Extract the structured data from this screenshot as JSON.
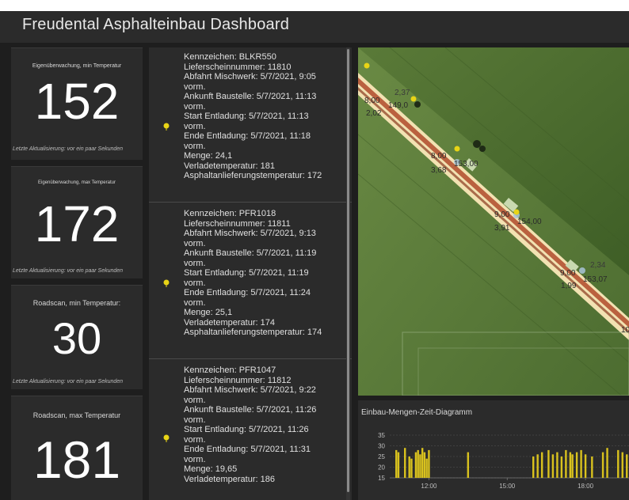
{
  "header": {
    "title": "Freudental Asphalteinbau Dashboard"
  },
  "indicators": [
    {
      "label": "Eigenüberwachung, min Temperatur",
      "value": "152",
      "updated": "Letzte Aktualisierung: vor ein paar Sekunden"
    },
    {
      "label": "Eigenüberwachung, max Temperatur",
      "value": "172",
      "updated": "Letzte Aktualisierung: vor ein paar Sekunden"
    },
    {
      "label": "Roadscan, min Temperatur:",
      "value": "30",
      "updated": "Letzte Aktualisierung: vor ein paar Sekunden"
    },
    {
      "label": "Roadscan, max Temperatur",
      "value": "181",
      "updated": "Letzte Aktualisierung: vor ein paar Sekunden"
    }
  ],
  "deliveries": [
    {
      "lines": [
        "Kennzeichen: BLKR550",
        "Lieferscheinnummer: 11810",
        "Abfahrt Mischwerk: 5/7/2021, 9:05",
        "vorm.",
        "Ankunft Baustelle: 5/7/2021, 11:13",
        "vorm.",
        "Start Entladung: 5/7/2021, 11:13",
        "vorm.",
        "Ende Entladung: 5/7/2021, 11:18",
        "vorm.",
        "Menge: 24,1",
        "Verladetemperatur: 181",
        "Asphaltanlieferungstemperatur: 172"
      ]
    },
    {
      "lines": [
        "Kennzeichen: PFR1018",
        "Lieferscheinnummer: 11811",
        "Abfahrt Mischwerk: 5/7/2021, 9:13",
        "vorm.",
        "Ankunft Baustelle: 5/7/2021, 11:19",
        "vorm.",
        "Start Entladung: 5/7/2021, 11:19",
        "vorm.",
        "Ende Entladung: 5/7/2021, 11:24",
        "vorm.",
        "Menge: 25,1",
        "Verladetemperatur: 174",
        "Asphaltanlieferungstemperatur: 174"
      ]
    },
    {
      "lines": [
        "Kennzeichen: PFR1047",
        "Lieferscheinnummer: 11812",
        "Abfahrt Mischwerk: 5/7/2021, 9:22",
        "vorm.",
        "Ankunft Baustelle: 5/7/2021, 11:26",
        "vorm.",
        "Start Entladung: 5/7/2021, 11:26",
        "vorm.",
        "Ende Entladung: 5/7/2021, 11:31",
        "vorm.",
        "Menge: 19,65",
        "Verladetemperatur: 186"
      ]
    }
  ],
  "map": {
    "labels": [
      {
        "text": "2,37"
      },
      {
        "text": "8,00"
      },
      {
        "text": "149,0"
      },
      {
        "text": "2,02"
      },
      {
        "text": "8,00"
      },
      {
        "text": "153,00"
      },
      {
        "text": "3,68"
      },
      {
        "text": "9,00"
      },
      {
        "text": "154,00"
      },
      {
        "text": "3,91"
      },
      {
        "text": "2,34"
      },
      {
        "text": "9,00"
      },
      {
        "text": "153,07"
      },
      {
        "text": "1,99"
      },
      {
        "text": "10"
      }
    ]
  },
  "chart": {
    "title": "Einbau-Mengen-Zeit-Diagramm"
  },
  "chart_data": {
    "type": "bar",
    "title": "Einbau-Mengen-Zeit-Diagramm",
    "ylim": [
      15,
      35
    ],
    "y_ticks": [
      "35",
      "30",
      "25",
      "20",
      "15"
    ],
    "x_ticks": [
      "12:00",
      "15:00",
      "18:00"
    ],
    "x_range": [
      "10:30",
      "19:40"
    ],
    "grid": true,
    "bar_color": "#d9c21e",
    "x": [
      "10:45",
      "10:50",
      "11:05",
      "11:15",
      "11:20",
      "11:30",
      "11:35",
      "11:40",
      "11:45",
      "11:50",
      "11:55",
      "12:00",
      "13:30",
      "16:00",
      "16:10",
      "16:20",
      "16:35",
      "16:45",
      "16:55",
      "17:05",
      "17:15",
      "17:25",
      "17:30",
      "17:40",
      "17:50",
      "18:00",
      "18:15",
      "18:40",
      "18:50",
      "19:15",
      "19:25",
      "19:35"
    ],
    "values": [
      28,
      27,
      29,
      25,
      24,
      27,
      28,
      26,
      29,
      27,
      24,
      28,
      27,
      25,
      26,
      27,
      28,
      26,
      27,
      25,
      28,
      27,
      26,
      27,
      28,
      26,
      25,
      27,
      29,
      28,
      27,
      26
    ]
  },
  "colors": {
    "background": "#1e1e1e",
    "panel": "#2b2b2b",
    "pin": "#e8d416",
    "road_red": "#b04a2a",
    "road_light": "#f2e2b2",
    "field": "#4e6e2f"
  },
  "icons": {
    "pin": "map-pin-icon"
  }
}
